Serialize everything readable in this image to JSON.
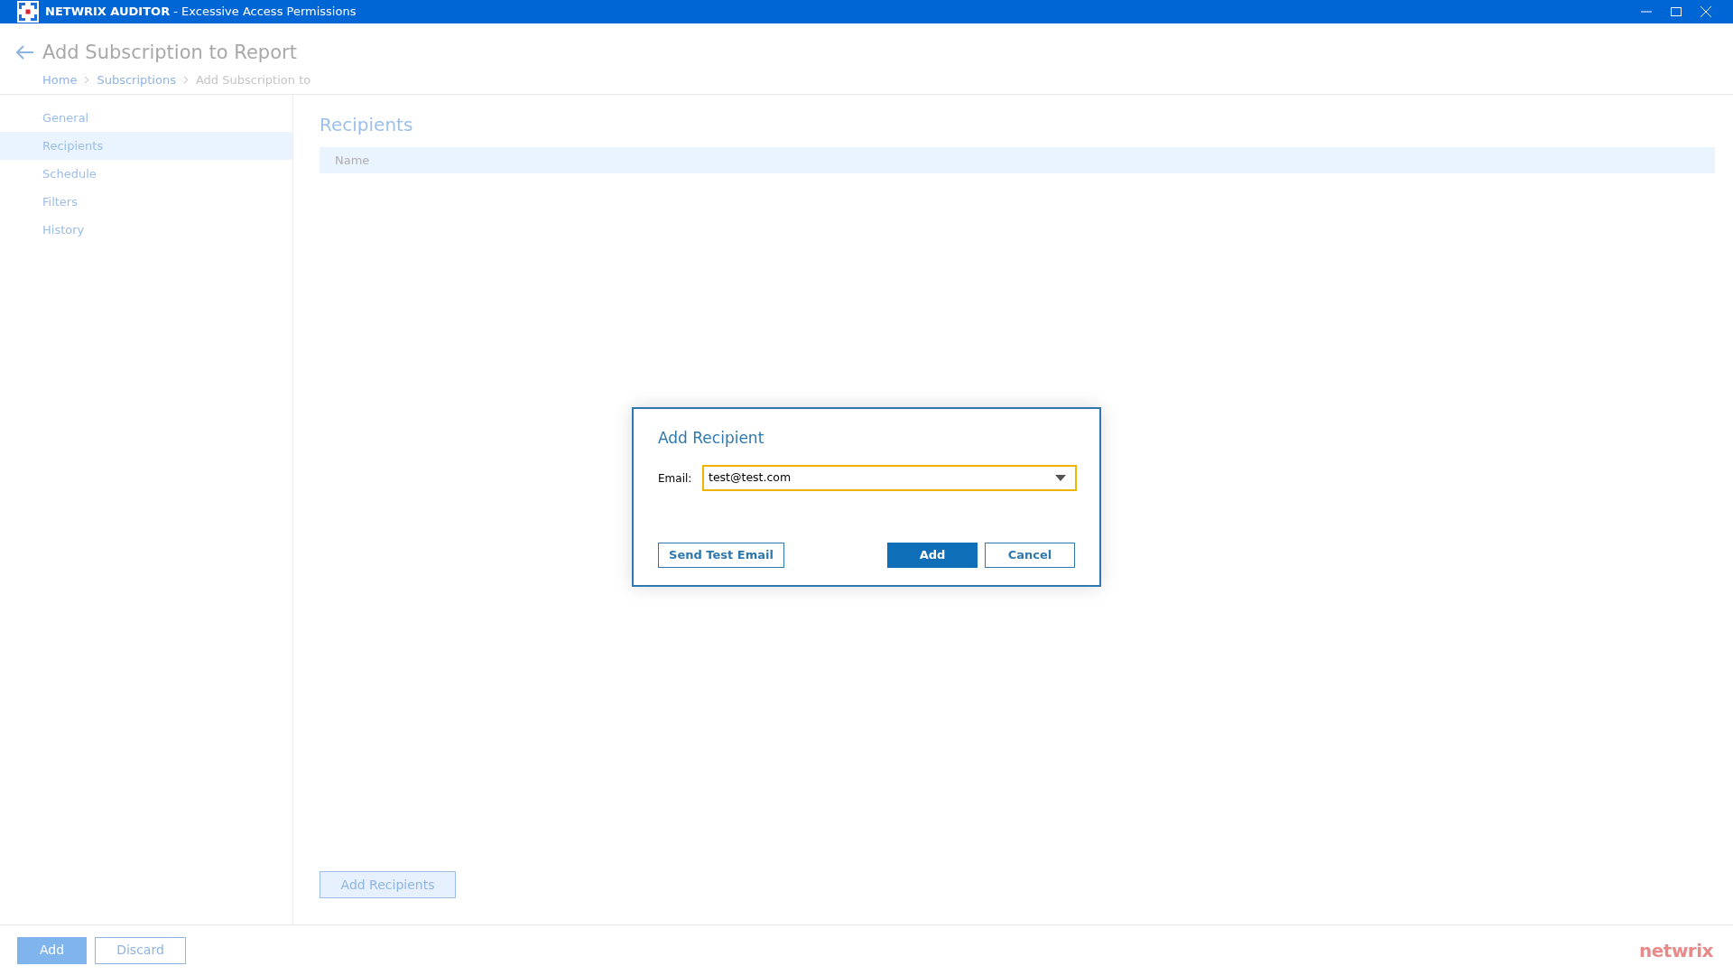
{
  "window": {
    "title": "**NETWRIX AUDITOR** - Excessive Access Permissions"
  },
  "header": {
    "title": "Add Subscription to Report",
    "breadcrumb": [
      "Home",
      "Subscriptions",
      "Add Subscription to"
    ]
  },
  "sidebar": {
    "items": [
      {
        "label": "General",
        "selected": false
      },
      {
        "label": "Recipients",
        "selected": true
      },
      {
        "label": "Schedule",
        "selected": false
      },
      {
        "label": "Filters",
        "selected": false
      },
      {
        "label": "History",
        "selected": false
      }
    ]
  },
  "content": {
    "heading": "Recipients",
    "table": {
      "columns": [
        "Name"
      ]
    },
    "add_button": "Add Recipients"
  },
  "dialog": {
    "title": "Add Recipient",
    "email_label": "Email:",
    "email_value": "test@test.com",
    "buttons": [
      {
        "label": "Send Test Email",
        "kind": "outline"
      },
      {
        "label": "Add",
        "kind": "primary"
      },
      {
        "label": "Cancel",
        "kind": "outline"
      }
    ]
  },
  "footer": {
    "buttons": [
      {
        "label": "Add",
        "kind": "primary"
      },
      {
        "label": "Discard",
        "kind": "outline"
      }
    ],
    "brand": "netwrix"
  }
}
